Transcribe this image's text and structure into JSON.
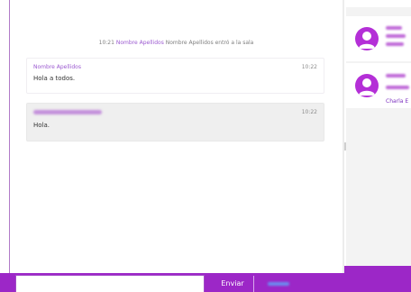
{
  "chat": {
    "system_message": {
      "time": "10:21",
      "name": "Nombre Apellidos",
      "text": "Nombre Apellidos entró a la sala"
    },
    "messages": [
      {
        "author": "Nombre Apellidos",
        "time": "10:22",
        "text": "Hola a todos."
      },
      {
        "author": "",
        "time": "10:22",
        "text": "Hola."
      }
    ]
  },
  "sidebar": {
    "users": [
      {
        "visible_text": ""
      },
      {
        "visible_text": "Charla E"
      }
    ]
  },
  "composer": {
    "input_value": "",
    "send_label": "Enviar"
  },
  "colors": {
    "accent": "#9c27c7",
    "avatar": "#b42fd7",
    "name_text": "#9b59d0",
    "message_bg": "#efefef"
  },
  "icons": {
    "avatar": "user-avatar-icon"
  }
}
